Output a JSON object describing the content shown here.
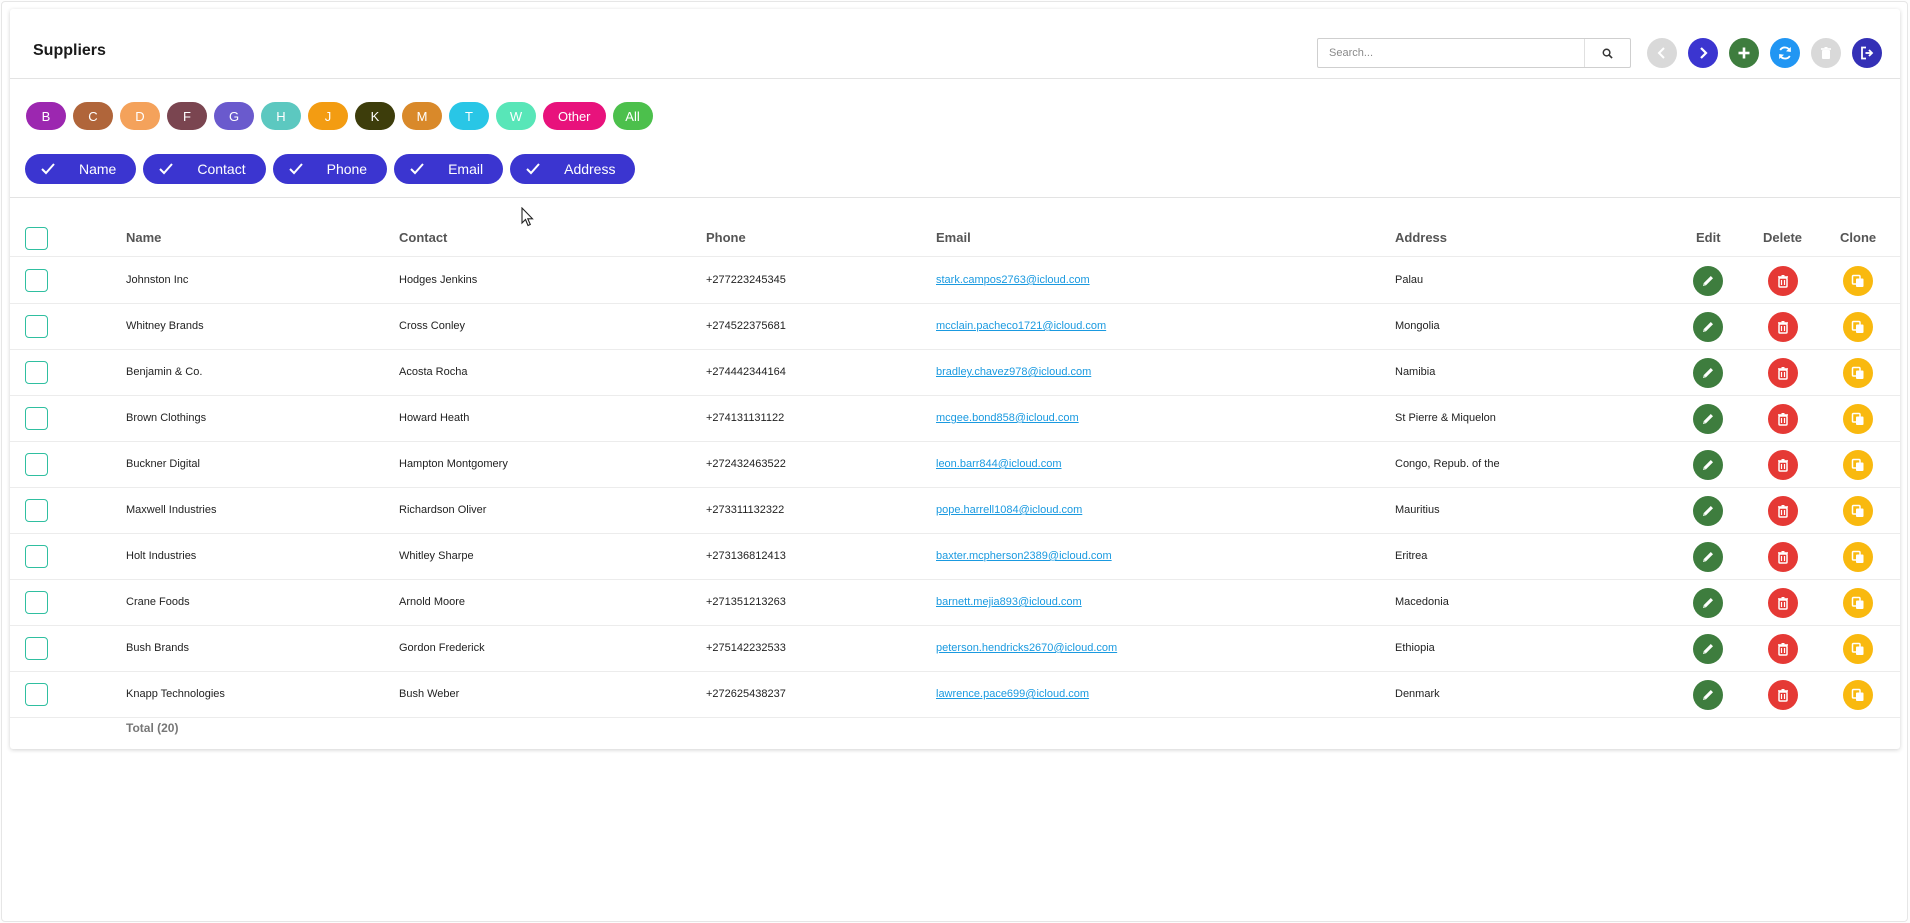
{
  "page": {
    "title": "Suppliers"
  },
  "search": {
    "placeholder": "Search..."
  },
  "toolbar": [
    {
      "name": "prev-button",
      "icon": "chevron-left-icon",
      "color": "#d9d9d9"
    },
    {
      "name": "next-button",
      "icon": "chevron-right-icon",
      "color": "#3b35d0"
    },
    {
      "name": "add-button",
      "icon": "plus-icon",
      "color": "#3e7d3e"
    },
    {
      "name": "refresh-button",
      "icon": "refresh-icon",
      "color": "#2196f3"
    },
    {
      "name": "delete-selected-button",
      "icon": "trash-icon",
      "color": "#d9d9d9"
    },
    {
      "name": "logout-button",
      "icon": "logout-icon",
      "color": "#3430b6"
    }
  ],
  "letter_filters": [
    {
      "label": "B",
      "color": "#9c27b0"
    },
    {
      "label": "C",
      "color": "#b0653a"
    },
    {
      "label": "D",
      "color": "#f4a25b"
    },
    {
      "label": "F",
      "color": "#7a4550"
    },
    {
      "label": "G",
      "color": "#6a5acd"
    },
    {
      "label": "H",
      "color": "#5cc8c0"
    },
    {
      "label": "J",
      "color": "#f39c12"
    },
    {
      "label": "K",
      "color": "#3d3d0b"
    },
    {
      "label": "M",
      "color": "#d9892a"
    },
    {
      "label": "T",
      "color": "#29c6e6"
    },
    {
      "label": "W",
      "color": "#58e6b8"
    },
    {
      "label": "Other",
      "color": "#e8127c"
    },
    {
      "label": "All",
      "color": "#4cc04c"
    }
  ],
  "column_filters": [
    "Name",
    "Contact",
    "Phone",
    "Email",
    "Address"
  ],
  "table": {
    "headers": {
      "name": "Name",
      "contact": "Contact",
      "phone": "Phone",
      "email": "Email",
      "address": "Address",
      "edit": "Edit",
      "delete": "Delete",
      "clone": "Clone"
    },
    "rows": [
      {
        "name": "Johnston Inc",
        "contact": "Hodges Jenkins",
        "phone": "+277223245345",
        "email": "stark.campos2763@icloud.com",
        "address": "Palau"
      },
      {
        "name": "Whitney Brands",
        "contact": "Cross Conley",
        "phone": "+274522375681",
        "email": "mcclain.pacheco1721@icloud.com",
        "address": "Mongolia"
      },
      {
        "name": "Benjamin & Co.",
        "contact": "Acosta Rocha",
        "phone": "+274442344164",
        "email": "bradley.chavez978@icloud.com",
        "address": "Namibia"
      },
      {
        "name": "Brown Clothings",
        "contact": "Howard Heath",
        "phone": "+274131131122",
        "email": "mcgee.bond858@icloud.com",
        "address": "St Pierre & Miquelon"
      },
      {
        "name": "Buckner Digital",
        "contact": "Hampton Montgomery",
        "phone": "+272432463522",
        "email": "leon.barr844@icloud.com",
        "address": "Congo, Repub. of the"
      },
      {
        "name": "Maxwell Industries",
        "contact": "Richardson Oliver",
        "phone": "+273311132322",
        "email": "pope.harrell1084@icloud.com",
        "address": "Mauritius"
      },
      {
        "name": "Holt Industries",
        "contact": "Whitley Sharpe",
        "phone": "+273136812413",
        "email": "baxter.mcpherson2389@icloud.com",
        "address": "Eritrea"
      },
      {
        "name": "Crane Foods",
        "contact": "Arnold Moore",
        "phone": "+271351213263",
        "email": "barnett.mejia893@icloud.com",
        "address": "Macedonia"
      },
      {
        "name": "Bush Brands",
        "contact": "Gordon Frederick",
        "phone": "+275142232533",
        "email": "peterson.hendricks2670@icloud.com",
        "address": "Ethiopia"
      },
      {
        "name": "Knapp Technologies",
        "contact": "Bush Weber",
        "phone": "+272625438237",
        "email": "lawrence.pace699@icloud.com",
        "address": "Denmark"
      }
    ],
    "total": "Total (20)"
  },
  "colors": {
    "edit": "#3e7d3e",
    "delete": "#e53935",
    "clone": "#f9b90f",
    "checkbox": "#2fbfa0",
    "chip": "#3b35d0",
    "link": "#1a9ae0"
  }
}
